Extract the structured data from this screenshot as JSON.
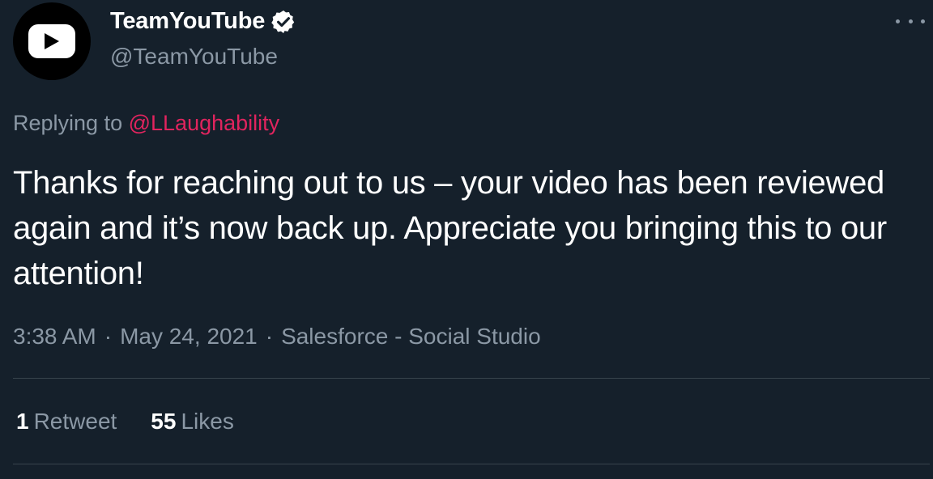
{
  "author": {
    "display_name": "TeamYouTube",
    "handle": "@TeamYouTube",
    "verified": true,
    "avatar_icon": "youtube-play-logo-icon"
  },
  "reply": {
    "prefix": "Replying to",
    "mention": "@LLaughability"
  },
  "tweet": {
    "text": "Thanks for reaching out to us – your video has been reviewed again and it’s now back up. Appreciate you bringing this to our attention!"
  },
  "meta": {
    "time": "3:38 AM",
    "date": "May 24, 2021",
    "source": "Salesforce - Social Studio",
    "separator": "·"
  },
  "stats": {
    "retweets_count": "1",
    "retweets_label": "Retweet",
    "likes_count": "55",
    "likes_label": "Likes"
  },
  "colors": {
    "background": "#15202b",
    "text_primary": "#ffffff",
    "text_secondary": "#8b98a5",
    "mention": "#e0245e",
    "divider": "#38444d"
  }
}
